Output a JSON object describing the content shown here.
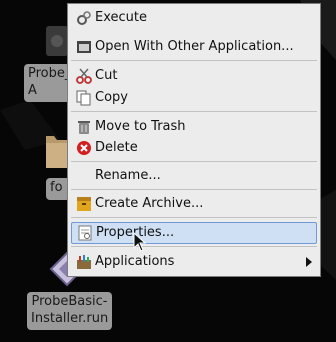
{
  "desktop": {
    "icons": [
      {
        "label": "Probe_\nA",
        "icon": "application-icon"
      },
      {
        "label": "fo",
        "icon": "folder-icon"
      },
      {
        "label": "ProbeBasic-\nInstaller.run",
        "icon": "run-script-icon"
      }
    ]
  },
  "context_menu": {
    "items": [
      {
        "label": "Execute",
        "icon": "gears-icon"
      },
      {
        "label": "Open With Other Application...",
        "icon": "open-with-icon"
      },
      {
        "label": "Cut",
        "icon": "scissors-icon"
      },
      {
        "label": "Copy",
        "icon": "copy-icon"
      },
      {
        "label": "Move to Trash",
        "icon": "trash-icon"
      },
      {
        "label": "Delete",
        "icon": "delete-icon"
      },
      {
        "label": "Rename...",
        "icon": ""
      },
      {
        "label": "Create Archive...",
        "icon": "archive-icon"
      },
      {
        "label": "Properties...",
        "icon": "properties-icon",
        "highlighted": true
      },
      {
        "label": "Applications",
        "icon": "applications-icon",
        "has_submenu": true
      }
    ]
  },
  "colors": {
    "menu_bg": "#ececec",
    "highlight_bg": "#cfe0f5",
    "highlight_border": "#6f9ad6",
    "desktop_bg": "#060606"
  }
}
